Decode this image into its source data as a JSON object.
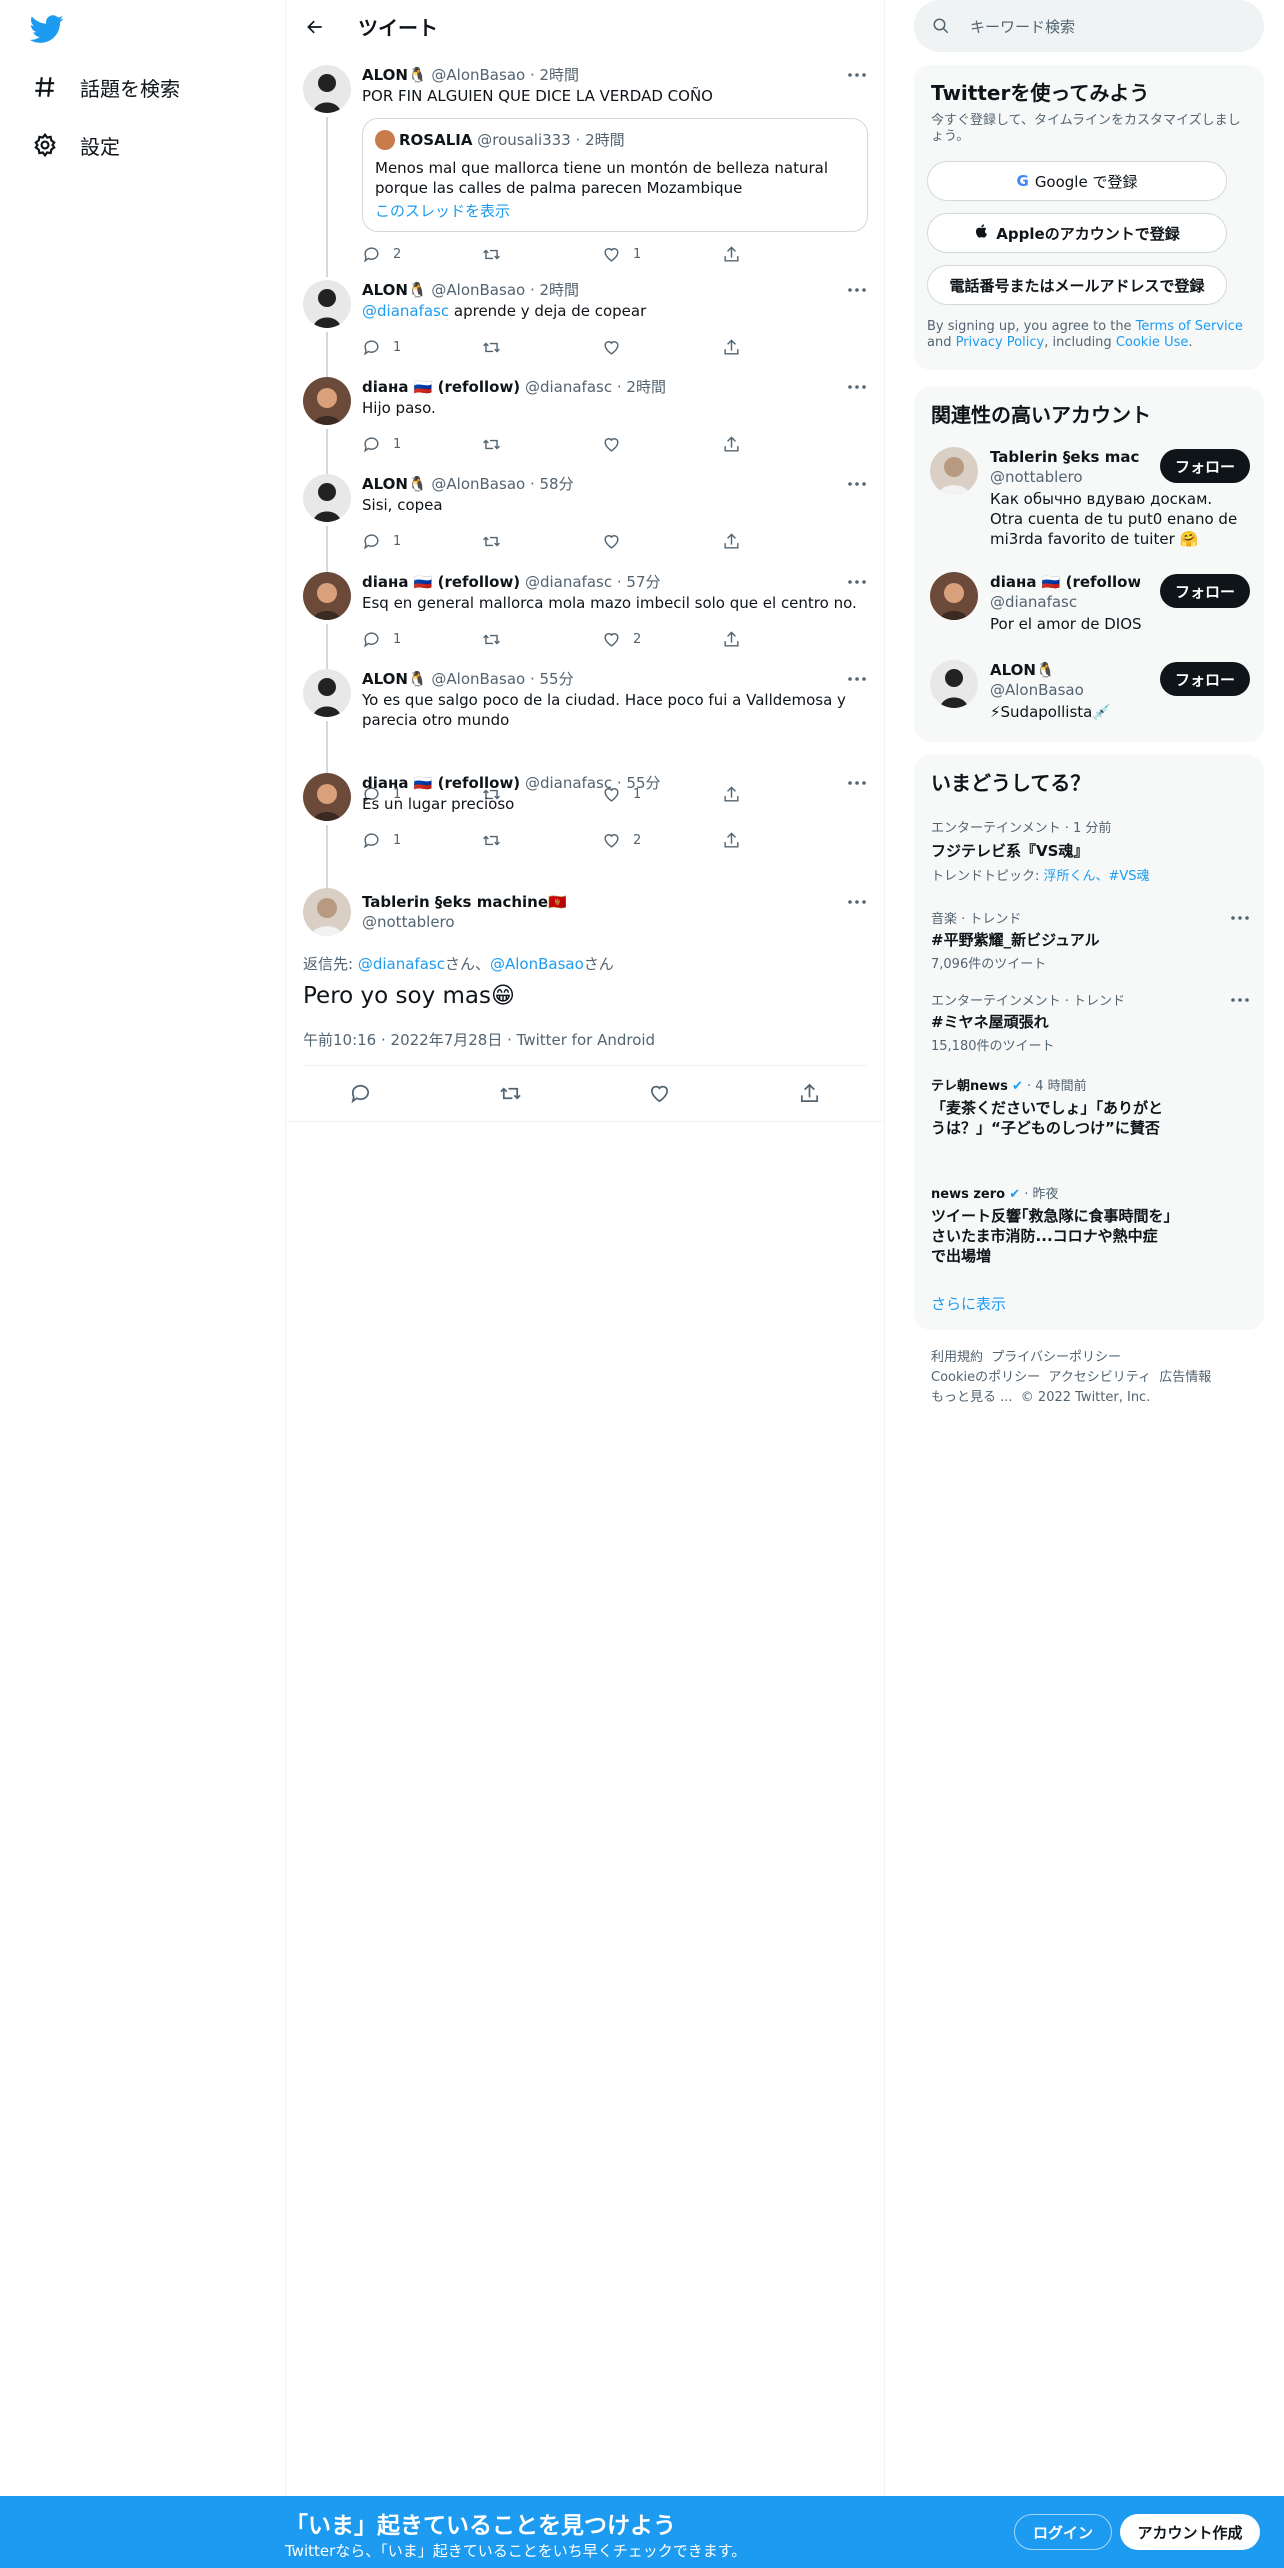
{
  "nav": {
    "explore_label": "話題を検索",
    "settings_label": "設定"
  },
  "header": {
    "title": "ツイート"
  },
  "tweets": [
    {
      "name": "ALON🐧",
      "handle": "@AlonBasao",
      "time": "· 2時間",
      "text": "POR FIN ALGUIEN QUE DICE LA VERDAD COÑO",
      "quote": {
        "name": "ROSALIA",
        "handle": "@rousali333",
        "time": "· 2時間",
        "text": "Menos mal que mallorca tiene un montón de belleza natural porque las calles de palma parecen Mozambique",
        "thread_link": "このスレッドを表示"
      },
      "replies": "2",
      "retweets": "",
      "likes": "1"
    },
    {
      "name": "ALON🐧",
      "handle": "@AlonBasao",
      "time": "· 2時間",
      "mention": "@dianafasc",
      "text": " aprende y deja de copear",
      "replies": "1",
      "retweets": "",
      "likes": ""
    },
    {
      "name": "diана 🇷🇺 (refollow)",
      "handle": "@dianafasc",
      "time": "· 2時間",
      "text": "Hijo paso.",
      "replies": "1",
      "retweets": "",
      "likes": ""
    },
    {
      "name": "ALON🐧",
      "handle": "@AlonBasao",
      "time": "· 58分",
      "text": "Sisi, copea",
      "replies": "1",
      "retweets": "",
      "likes": ""
    },
    {
      "name": "diана 🇷🇺 (refollow)",
      "handle": "@dianafasc",
      "time": "· 57分",
      "text": "Esq en general mallorca mola mazo imbecil solo que el centro no.",
      "replies": "1",
      "retweets": "",
      "likes": "2"
    },
    {
      "name": "ALON🐧",
      "handle": "@AlonBasao",
      "time": "· 55分",
      "text": "Yo es que salgo poco de la ciudad. Hace poco fui a Valldemosa y parecia otro mundo",
      "replies": "1",
      "retweets": "",
      "likes": "1"
    },
    {
      "name": "diана 🇷🇺 (refollow)",
      "handle": "@dianafasc",
      "time": "· 55分",
      "text": "Es un lugar precioso",
      "replies": "1",
      "retweets": "",
      "likes": "2"
    }
  ],
  "focus": {
    "name": "Tablerin §eks machine🇲🇪",
    "handle": "@nottablero",
    "reply_to_prefix": "返信先: ",
    "reply_to_1": "@dianafasc",
    "reply_to_sep": "さん、",
    "reply_to_2": "@AlonBasao",
    "reply_to_suffix": "さん",
    "text": "Pero yo soy mas😁",
    "meta": "午前10:16 · 2022年7月28日 · Twitter for Android"
  },
  "sidebar": {
    "search_placeholder": "キーワード検索",
    "signup": {
      "title": "Twitterを使ってみよう",
      "subtitle": "今すぐ登録して、タイムラインをカスタマイズしましょう。",
      "google": "Google で登録",
      "apple": "Appleのアカウントで登録",
      "phone": "電話番号またはメールアドレスで登録",
      "legal_1": "By signing up, you agree to the ",
      "tos": "Terms of Service",
      "legal_2": " and ",
      "privacy": "Privacy Policy",
      "legal_3": ", including ",
      "cookie": "Cookie Use",
      "legal_4": "."
    },
    "relevant": {
      "title": "関連性の高いアカウント",
      "accounts": [
        {
          "name": "Tablerin §eks machin...",
          "handle": "@nottablero",
          "bio": "Как обычно вдуваю доскам. Otra cuenta de tu put0 enano de mi3rda favorito de tuiter 🤗",
          "follow": "フォロー"
        },
        {
          "name": "diана 🇷🇺 (refollow)",
          "handle": "@dianafasc",
          "bio": "Por el amor de DIOS",
          "follow": "フォロー"
        },
        {
          "name": "ALON🐧",
          "handle": "@AlonBasao",
          "bio": "⚡Sudapollista💉",
          "follow": "フォロー"
        }
      ]
    },
    "trends": {
      "title": "いまどうしてる？",
      "items": [
        {
          "meta": "エンターテインメント · 1 分前",
          "title": "フジテレビ系『VS魂』",
          "extra_prefix": "トレンドトピック: ",
          "extra_links": "浮所くん、#VS魂"
        },
        {
          "meta": "音楽 · トレンド",
          "title": "#平野紫耀_新ビジュアル",
          "count": "7,096件のツイート"
        },
        {
          "meta": "エンターテインメント · トレンド",
          "title": "#ミヤネ屋頑張れ",
          "count": "15,180件のツイート"
        },
        {
          "source": "テレ朝news",
          "time": "· 4 時間前",
          "title": "「麦茶くださいでしょ」「ありがとうは？」“子どものしつけ”に賛否"
        },
        {
          "source": "news zero",
          "time": "· 昨夜",
          "title": "ツイート反響｢救急隊に食事時間を｣さいたま市消防...コロナや熱中症で出場増"
        }
      ],
      "show_more": "さらに表示"
    },
    "footer": {
      "terms": "利用規約",
      "privacy": "プライバシーポリシー",
      "cookie": "Cookieのポリシー",
      "accessibility": "アクセシビリティ",
      "ads": "広告情報",
      "more": "もっと見る ...",
      "copyright": "© 2022 Twitter, Inc."
    }
  },
  "bottom_bar": {
    "title": "「いま」起きていることを見つけよう",
    "subtitle": "Twitterなら、「いま」起きていることをいち早くチェックできます。",
    "login": "ログイン",
    "signup": "アカウント作成"
  }
}
